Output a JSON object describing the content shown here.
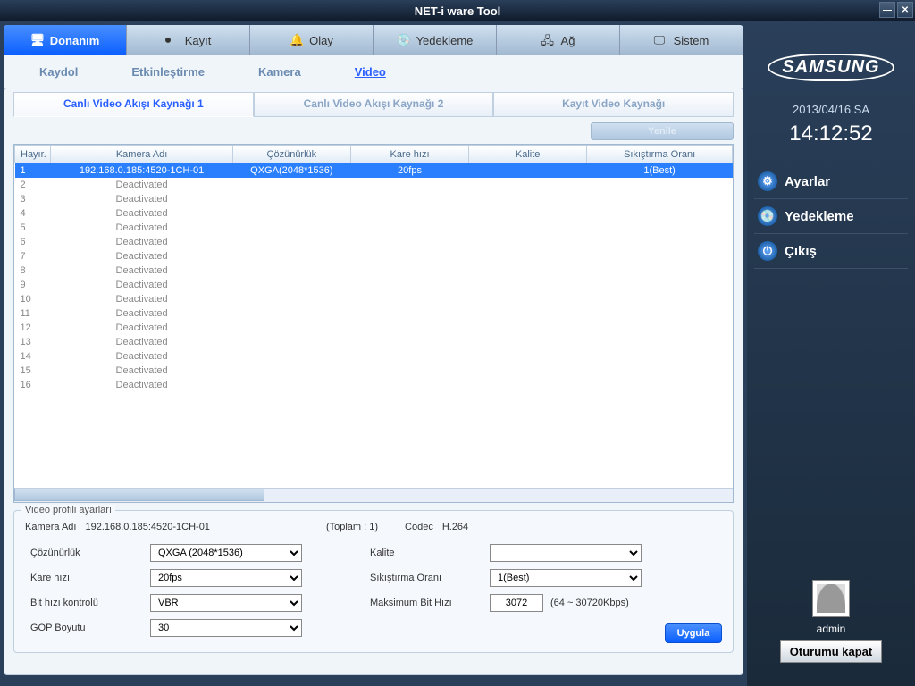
{
  "title": "NET-i ware Tool",
  "mainTabs": [
    "Donanım",
    "Kayıt",
    "Olay",
    "Yedekleme",
    "Ağ",
    "Sistem"
  ],
  "subTabs": [
    "Kaydol",
    "Etkinleştirme",
    "Kamera",
    "Video"
  ],
  "sourceTabs": [
    "Canlı Video Akışı Kaynağı 1",
    "Canlı Video Akışı Kaynağı 2",
    "Kayıt Video Kaynağı"
  ],
  "refresh": "Yenile",
  "columns": {
    "no": "Hayır.",
    "name": "Kamera Adı",
    "res": "Çözünürlük",
    "fps": "Kare hızı",
    "q": "Kalite",
    "comp": "Sıkıştırma Oranı"
  },
  "rows": [
    {
      "no": "1",
      "name": "192.168.0.185:4520-1CH-01",
      "res": "QXGA(2048*1536)",
      "fps": "20fps",
      "q": "",
      "comp": "1(Best)",
      "sel": true
    },
    {
      "no": "2",
      "name": "Deactivated"
    },
    {
      "no": "3",
      "name": "Deactivated"
    },
    {
      "no": "4",
      "name": "Deactivated"
    },
    {
      "no": "5",
      "name": "Deactivated"
    },
    {
      "no": "6",
      "name": "Deactivated"
    },
    {
      "no": "7",
      "name": "Deactivated"
    },
    {
      "no": "8",
      "name": "Deactivated"
    },
    {
      "no": "9",
      "name": "Deactivated"
    },
    {
      "no": "10",
      "name": "Deactivated"
    },
    {
      "no": "11",
      "name": "Deactivated"
    },
    {
      "no": "12",
      "name": "Deactivated"
    },
    {
      "no": "13",
      "name": "Deactivated"
    },
    {
      "no": "14",
      "name": "Deactivated"
    },
    {
      "no": "15",
      "name": "Deactivated"
    },
    {
      "no": "16",
      "name": "Deactivated"
    }
  ],
  "profile": {
    "legend": "Video profili ayarları",
    "camLabel": "Kamera Adı",
    "camName": "192.168.0.185:4520-1CH-01",
    "total": "(Toplam : 1)",
    "codecLabel": "Codec",
    "codec": "H.264",
    "resLabel": "Çözünürlük",
    "resVal": "QXGA (2048*1536)",
    "fpsLabel": "Kare hızı",
    "fpsVal": "20fps",
    "brcLabel": "Bit hızı kontrolü",
    "brcVal": "VBR",
    "gopLabel": "GOP Boyutu",
    "gopVal": "30",
    "qLabel": "Kalite",
    "qVal": "",
    "compLabel": "Sıkıştırma Oranı",
    "compVal": "1(Best)",
    "maxbrLabel": "Maksimum Bit Hızı",
    "maxbrVal": "3072",
    "maxbrHint": "(64 ~ 30720Kbps)",
    "apply": "Uygula"
  },
  "side": {
    "date": "2013/04/16  SA",
    "time": "14:12:52",
    "settings": "Ayarlar",
    "backup": "Yedekleme",
    "exit": "Çıkış",
    "user": "admin",
    "logout": "Oturumu kapat",
    "brand": "SAMSUNG"
  }
}
